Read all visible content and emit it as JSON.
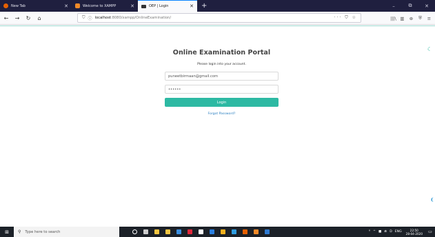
{
  "browser": {
    "tabs": [
      {
        "title": "New Tab",
        "icon_color": "#e66000",
        "active": false
      },
      {
        "title": "Welcome to XAMPP",
        "icon_color": "#f28a29",
        "active": false
      },
      {
        "title": "OEP | Login",
        "icon_color": "#333333",
        "active": true
      }
    ],
    "new_tab_glyph": "+",
    "window_controls": [
      "–",
      "⧉",
      "✕"
    ],
    "url_host": "localhost",
    "url_path": ":8080/xampp/OnlineExamination/",
    "url_actions": "··· ⛉ ☆",
    "tools": [
      "|||\\",
      "▥",
      "⊛",
      "⛨",
      "≡"
    ]
  },
  "login": {
    "title": "Online Examination Portal",
    "subtitle": "Please login into your account.",
    "email_value": "puneetbirmaan@gmail.com",
    "password_value": "••••••",
    "login_label": "Login",
    "forgot_label": "Forgot Password?"
  },
  "taskbar": {
    "search_placeholder": "Type here to search",
    "tray_items": [
      "ᴿ",
      "^",
      "■",
      "⋒",
      "D",
      "ENG"
    ],
    "time": "22:50",
    "date": "28-04-2020",
    "apps": [
      {
        "name": "cortana-icon",
        "color": "#ffffff"
      },
      {
        "name": "task-view-icon",
        "color": "#cccccc"
      },
      {
        "name": "file-explorer-icon",
        "color": "#f4c542"
      },
      {
        "name": "store-icon",
        "color": "#f4c542"
      },
      {
        "name": "mail-icon",
        "color": "#3b8fe0"
      },
      {
        "name": "opera-icon",
        "color": "#e0283b"
      },
      {
        "name": "files-icon",
        "color": "#ffffff"
      },
      {
        "name": "edge-icon",
        "color": "#2a7fe0"
      },
      {
        "name": "chrome-icon",
        "color": "#f2b01e"
      },
      {
        "name": "messenger-icon",
        "color": "#2f9de0"
      },
      {
        "name": "firefox-icon",
        "color": "#e66000"
      },
      {
        "name": "xampp-icon",
        "color": "#f28a29"
      },
      {
        "name": "vscode-icon",
        "color": "#2f7ad0"
      }
    ]
  }
}
